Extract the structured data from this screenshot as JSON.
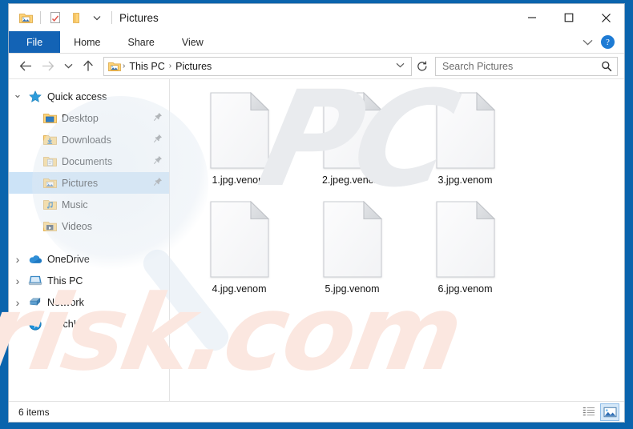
{
  "window": {
    "title": "Pictures",
    "quick_access_toolbar": [
      {
        "name": "pictures-folder-icon",
        "label": "Pictures folder"
      },
      {
        "name": "properties-icon",
        "label": "Properties"
      },
      {
        "name": "new-folder-icon",
        "label": "New folder"
      },
      {
        "name": "customize-dropdown-icon",
        "label": "Customize Quick Access Toolbar"
      }
    ],
    "caption": {
      "minimize": "–",
      "maximize": "□",
      "close": "✕"
    }
  },
  "ribbon": {
    "tabs": [
      {
        "label": "File",
        "active": true
      },
      {
        "label": "Home",
        "active": false
      },
      {
        "label": "Share",
        "active": false
      },
      {
        "label": "View",
        "active": false
      }
    ],
    "expand_label": "⌄",
    "help_label": "?"
  },
  "address": {
    "back_label": "←",
    "forward_label": "→",
    "recent_label": "⌄",
    "up_label": "↑",
    "breadcrumb": [
      "This PC",
      "Pictures"
    ],
    "breadcrumb_separator": "›",
    "dropdown_label": "⌄",
    "refresh_label": "↻"
  },
  "search": {
    "placeholder": "Search Pictures",
    "icon": "search-icon"
  },
  "sidebar": {
    "items": [
      {
        "label": "Quick access",
        "icon": "star-icon",
        "chevron": "open",
        "indent": false,
        "pinned": false,
        "selected": false
      },
      {
        "label": "Desktop",
        "icon": "desktop-folder-icon",
        "chevron": "none",
        "indent": true,
        "pinned": true,
        "selected": false
      },
      {
        "label": "Downloads",
        "icon": "downloads-folder-icon",
        "chevron": "none",
        "indent": true,
        "pinned": true,
        "selected": false
      },
      {
        "label": "Documents",
        "icon": "documents-folder-icon",
        "chevron": "none",
        "indent": true,
        "pinned": true,
        "selected": false
      },
      {
        "label": "Pictures",
        "icon": "pictures-folder-icon",
        "chevron": "none",
        "indent": true,
        "pinned": true,
        "selected": true
      },
      {
        "label": "Music",
        "icon": "music-folder-icon",
        "chevron": "none",
        "indent": true,
        "pinned": false,
        "selected": false
      },
      {
        "label": "Videos",
        "icon": "videos-folder-icon",
        "chevron": "none",
        "indent": true,
        "pinned": false,
        "selected": false
      },
      {
        "label": "OneDrive",
        "icon": "onedrive-cloud-icon",
        "chevron": "closed",
        "indent": false,
        "pinned": false,
        "selected": false
      },
      {
        "label": "This PC",
        "icon": "this-pc-icon",
        "chevron": "closed",
        "indent": false,
        "pinned": false,
        "selected": false
      },
      {
        "label": "Network",
        "icon": "network-icon",
        "chevron": "closed",
        "indent": false,
        "pinned": false,
        "selected": false
      },
      {
        "label": "Catch!",
        "icon": "catch-icon",
        "chevron": "closed",
        "indent": false,
        "pinned": false,
        "selected": false
      }
    ],
    "pin_glyph": "📌"
  },
  "files": [
    {
      "name": "1.jpg.venom",
      "icon": "blank-document-icon"
    },
    {
      "name": "2.jpeg.venom",
      "icon": "blank-document-icon"
    },
    {
      "name": "3.jpg.venom",
      "icon": "blank-document-icon"
    },
    {
      "name": "4.jpg.venom",
      "icon": "blank-document-icon"
    },
    {
      "name": "5.jpg.venom",
      "icon": "blank-document-icon"
    },
    {
      "name": "6.jpg.venom",
      "icon": "blank-document-icon"
    }
  ],
  "status": {
    "item_count": "6 items",
    "views": [
      {
        "name": "details-view-button",
        "active": false
      },
      {
        "name": "large-icons-view-button",
        "active": true
      }
    ]
  },
  "watermark": {
    "grey_text": "PC",
    "pink_text": "risk.com"
  },
  "colors": {
    "desktop": "#0a64ad",
    "file_tab": "#1363b5",
    "selection": "#cce3f7",
    "help_blue": "#1e7bd4",
    "folder_yellow": "#ffc95b",
    "watermark_pink": "#fbe7e0",
    "watermark_grey": "#e9ebee"
  }
}
